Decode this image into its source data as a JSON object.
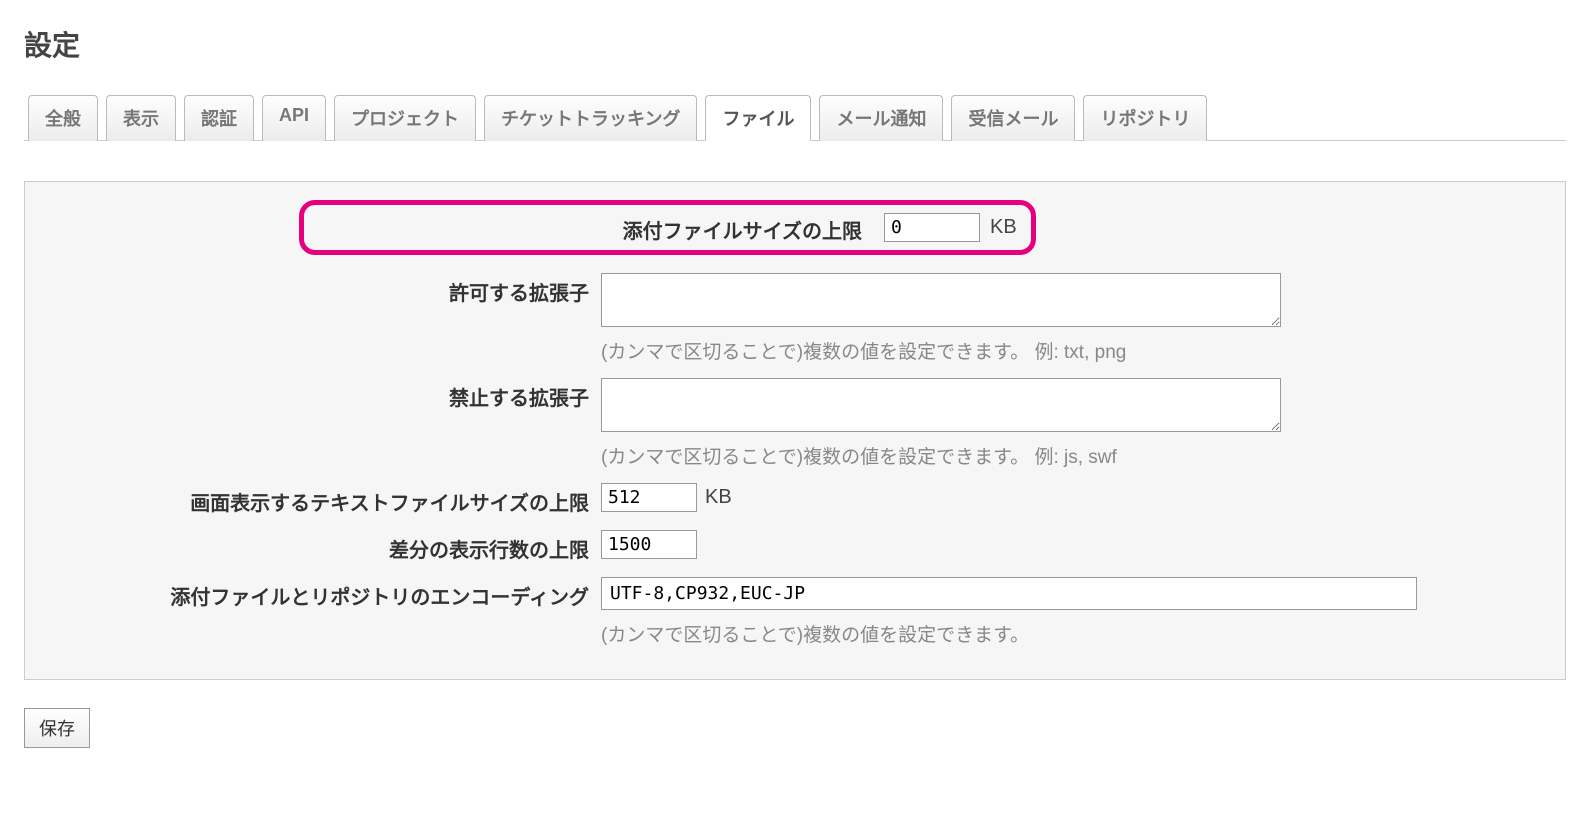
{
  "page_title": "設定",
  "tabs": [
    {
      "label": "全般"
    },
    {
      "label": "表示"
    },
    {
      "label": "認証"
    },
    {
      "label": "API"
    },
    {
      "label": "プロジェクト"
    },
    {
      "label": "チケットトラッキング"
    },
    {
      "label": "ファイル",
      "active": true
    },
    {
      "label": "メール通知"
    },
    {
      "label": "受信メール"
    },
    {
      "label": "リポジトリ"
    }
  ],
  "fields": {
    "max_attachment": {
      "label": "添付ファイルサイズの上限",
      "value": "0",
      "unit": "KB"
    },
    "allowed_ext": {
      "label": "許可する拡張子",
      "value": "",
      "hint": "(カンマで区切ることで)複数の値を設定できます。 例: txt, png"
    },
    "denied_ext": {
      "label": "禁止する拡張子",
      "value": "",
      "hint": "(カンマで区切ることで)複数の値を設定できます。 例: js, swf"
    },
    "max_inline": {
      "label": "画面表示するテキストファイルサイズの上限",
      "value": "512",
      "unit": "KB"
    },
    "max_diff": {
      "label": "差分の表示行数の上限",
      "value": "1500"
    },
    "encodings": {
      "label": "添付ファイルとリポジトリのエンコーディング",
      "value": "UTF-8,CP932,EUC-JP",
      "hint": "(カンマで区切ることで)複数の値を設定できます。"
    }
  },
  "save_button": "保存"
}
